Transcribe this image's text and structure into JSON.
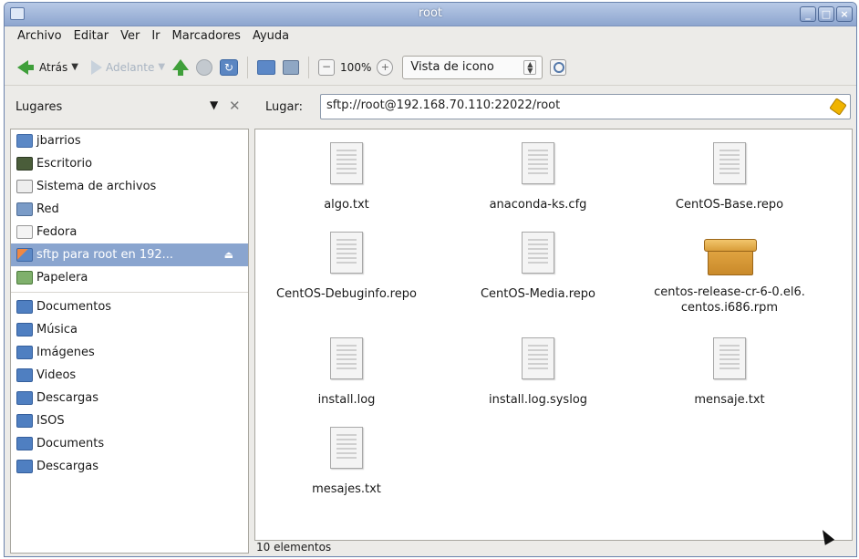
{
  "window": {
    "title": "root"
  },
  "menubar": {
    "items": [
      {
        "label": "Archivo"
      },
      {
        "label": "Editar"
      },
      {
        "label": "Ver"
      },
      {
        "label": "Ir"
      },
      {
        "label": "Marcadores"
      },
      {
        "label": "Ayuda"
      }
    ]
  },
  "toolbar": {
    "back_label": "Atrás",
    "forward_label": "Adelante",
    "zoom_level": "100%",
    "view_mode": "Vista de icono"
  },
  "location": {
    "places_header": "Lugares",
    "label": "Lugar:",
    "value": "sftp://root@192.168.70.110:22022/root"
  },
  "sidebar": {
    "items": [
      {
        "label": "jbarrios",
        "icon": "home-folder-icon"
      },
      {
        "label": "Escritorio",
        "icon": "desktop-icon"
      },
      {
        "label": "Sistema de archivos",
        "icon": "filesystem-icon"
      },
      {
        "label": "Red",
        "icon": "network-icon"
      },
      {
        "label": "Fedora",
        "icon": "drive-icon"
      },
      {
        "label": "sftp para root en 192...",
        "icon": "sftp-icon",
        "selected": true
      },
      {
        "label": "Papelera",
        "icon": "trash-icon"
      },
      {
        "label": "Documentos",
        "icon": "folder-icon"
      },
      {
        "label": "Música",
        "icon": "folder-icon"
      },
      {
        "label": "Imágenes",
        "icon": "folder-icon"
      },
      {
        "label": "Videos",
        "icon": "folder-icon"
      },
      {
        "label": "Descargas",
        "icon": "folder-icon"
      },
      {
        "label": "ISOS",
        "icon": "folder-icon"
      },
      {
        "label": "Documents",
        "icon": "folder-icon"
      },
      {
        "label": "Descargas",
        "icon": "folder-icon"
      }
    ]
  },
  "files": [
    {
      "name": "algo.txt",
      "icon": "text-file-icon"
    },
    {
      "name": "anaconda-ks.cfg",
      "icon": "text-file-icon"
    },
    {
      "name": "CentOS-Base.repo",
      "icon": "text-file-icon"
    },
    {
      "name": "CentOS-Debuginfo.repo",
      "icon": "text-file-icon"
    },
    {
      "name": "CentOS-Media.repo",
      "icon": "text-file-icon"
    },
    {
      "name": "centos-release-cr-6-0.el6.centos.i686.rpm",
      "icon": "package-icon"
    },
    {
      "name": "install.log",
      "icon": "text-file-icon"
    },
    {
      "name": "install.log.syslog",
      "icon": "text-file-icon"
    },
    {
      "name": "mensaje.txt",
      "icon": "text-file-icon"
    },
    {
      "name": "mesajes.txt",
      "icon": "text-file-icon"
    }
  ],
  "status": {
    "text": "10 elementos"
  },
  "colors": {
    "titlebar": "#8ea6cf",
    "selection": "#8aa5cf",
    "folder": "#4f7fc1"
  }
}
